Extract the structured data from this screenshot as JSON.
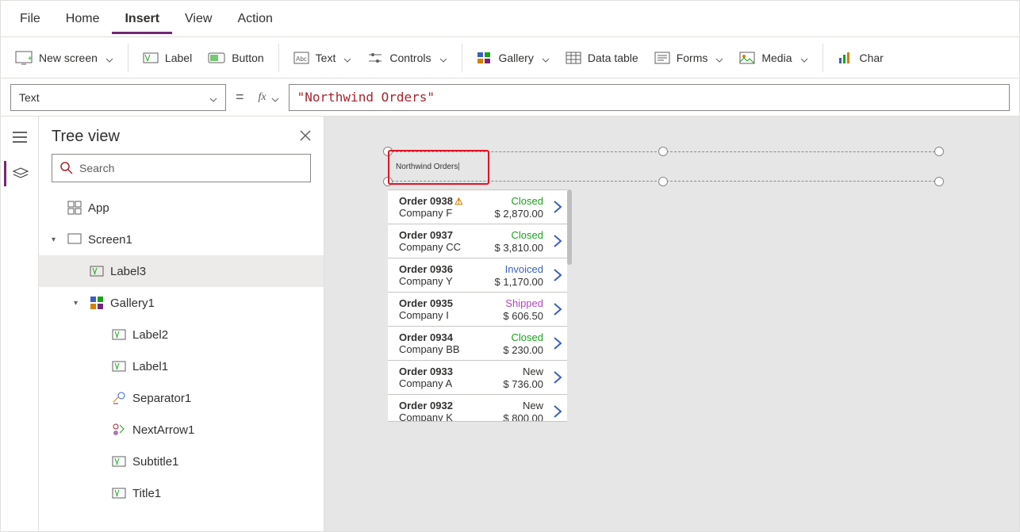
{
  "menu": {
    "file": "File",
    "home": "Home",
    "insert": "Insert",
    "view": "View",
    "action": "Action",
    "active": "insert"
  },
  "ribbon": {
    "new_screen": "New screen",
    "label": "Label",
    "button": "Button",
    "text": "Text",
    "controls": "Controls",
    "gallery": "Gallery",
    "data_table": "Data table",
    "forms": "Forms",
    "media": "Media",
    "chart": "Char"
  },
  "formula": {
    "property": "Text",
    "value": "\"Northwind Orders\""
  },
  "tree": {
    "title": "Tree view",
    "search_placeholder": "Search",
    "nodes": [
      {
        "kind": "app",
        "label": "App",
        "indent": 0,
        "chev": ""
      },
      {
        "kind": "screen",
        "label": "Screen1",
        "indent": 0,
        "chev": "▾"
      },
      {
        "kind": "label",
        "label": "Label3",
        "indent": 1,
        "chev": "",
        "sel": true
      },
      {
        "kind": "gallery",
        "label": "Gallery1",
        "indent": 1,
        "chev": "▾"
      },
      {
        "kind": "label",
        "label": "Label2",
        "indent": 2,
        "chev": ""
      },
      {
        "kind": "label",
        "label": "Label1",
        "indent": 2,
        "chev": ""
      },
      {
        "kind": "sep",
        "label": "Separator1",
        "indent": 2,
        "chev": ""
      },
      {
        "kind": "arrow",
        "label": "NextArrow1",
        "indent": 2,
        "chev": ""
      },
      {
        "kind": "label",
        "label": "Subtitle1",
        "indent": 2,
        "chev": ""
      },
      {
        "kind": "label",
        "label": "Title1",
        "indent": 2,
        "chev": ""
      }
    ]
  },
  "canvas": {
    "selected_label_text": "Northwind Orders",
    "rows": [
      {
        "order": "Order 0938",
        "warn": true,
        "company": "Company F",
        "status": "Closed",
        "amount": "$ 2,870.00"
      },
      {
        "order": "Order 0937",
        "company": "Company CC",
        "status": "Closed",
        "amount": "$ 3,810.00"
      },
      {
        "order": "Order 0936",
        "company": "Company Y",
        "status": "Invoiced",
        "amount": "$ 1,170.00"
      },
      {
        "order": "Order 0935",
        "company": "Company I",
        "status": "Shipped",
        "amount": "$ 606.50"
      },
      {
        "order": "Order 0934",
        "company": "Company BB",
        "status": "Closed",
        "amount": "$ 230.00"
      },
      {
        "order": "Order 0933",
        "company": "Company A",
        "status": "New",
        "amount": "$ 736.00"
      },
      {
        "order": "Order 0932",
        "company": "Company K",
        "status": "New",
        "amount": "$ 800.00"
      }
    ]
  }
}
